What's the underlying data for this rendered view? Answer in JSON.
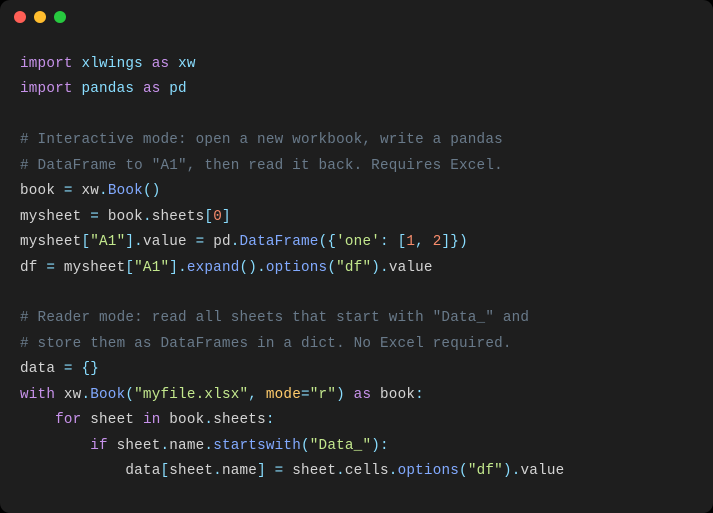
{
  "window": {
    "dots": [
      "red",
      "yellow",
      "green"
    ]
  },
  "code": {
    "l1": {
      "kw1": "import",
      "mod": "xlwings",
      "kw2": "as",
      "alias": "xw"
    },
    "l2": {
      "kw1": "import",
      "mod": "pandas",
      "kw2": "as",
      "alias": "pd"
    },
    "l3": "",
    "l4": "# Interactive mode: open a new workbook, write a pandas",
    "l5": "# DataFrame to \"A1\", then read it back. Requires Excel.",
    "l6": {
      "lhs": "book",
      "eq": "=",
      "obj": "xw",
      "dot": ".",
      "fn": "Book",
      "par": "()"
    },
    "l7": {
      "lhs": "mysheet",
      "eq": "=",
      "rhs_obj": "book",
      "d1": ".",
      "attr": "sheets",
      "br_o": "[",
      "idx": "0",
      "br_c": "]"
    },
    "l8": {
      "obj": "mysheet",
      "br_o": "[",
      "key": "\"A1\"",
      "br_c": "]",
      "d1": ".",
      "attr": "value",
      "eq": "=",
      "pd": "pd",
      "d2": ".",
      "fn": "DataFrame",
      "po": "(",
      "bo": "{",
      "k": "'one'",
      "colon": ":",
      "lo": "[",
      "n1": "1",
      "comma": ",",
      "n2": "2",
      "lc": "]",
      "bc": "}",
      "pc": ")"
    },
    "l9": {
      "lhs": "df",
      "eq": "=",
      "obj": "mysheet",
      "br_o": "[",
      "key": "\"A1\"",
      "br_c": "]",
      "d1": ".",
      "fn1": "expand",
      "p1": "()",
      "d2": ".",
      "fn2": "options",
      "p2o": "(",
      "arg": "\"df\"",
      "p2c": ")",
      "d3": ".",
      "attr": "value"
    },
    "l10": "",
    "l11": "# Reader mode: read all sheets that start with \"Data_\" and",
    "l12": "# store them as DataFrames in a dict. No Excel required.",
    "l13": {
      "lhs": "data",
      "eq": "=",
      "bo": "{",
      "bc": "}"
    },
    "l14": {
      "kw": "with",
      "obj": "xw",
      "d": ".",
      "fn": "Book",
      "po": "(",
      "a1": "\"myfile.xlsx\"",
      "comma": ",",
      "kwarg": "mode",
      "eq": "=",
      "a2": "\"r\"",
      "pc": ")",
      "kw2": "as",
      "name": "book",
      "colon": ":"
    },
    "l15": {
      "indent": "    ",
      "kw": "for",
      "var": "sheet",
      "kw2": "in",
      "obj": "book",
      "d": ".",
      "attr": "sheets",
      "colon": ":"
    },
    "l16": {
      "indent": "        ",
      "kw": "if",
      "obj": "sheet",
      "d": ".",
      "attr": "name",
      "d2": ".",
      "fn": "startswith",
      "po": "(",
      "arg": "\"Data_\"",
      "pc": ")",
      "colon": ":"
    },
    "l17": {
      "indent": "            ",
      "obj": "data",
      "bo": "[",
      "k_obj": "sheet",
      "d": ".",
      "k_attr": "name",
      "bc": "]",
      "eq": "=",
      "r_obj": "sheet",
      "d2": ".",
      "r_attr": "cells",
      "d3": ".",
      "fn": "options",
      "po": "(",
      "arg": "\"df\"",
      "pc": ")",
      "d4": ".",
      "attr2": "value"
    }
  }
}
